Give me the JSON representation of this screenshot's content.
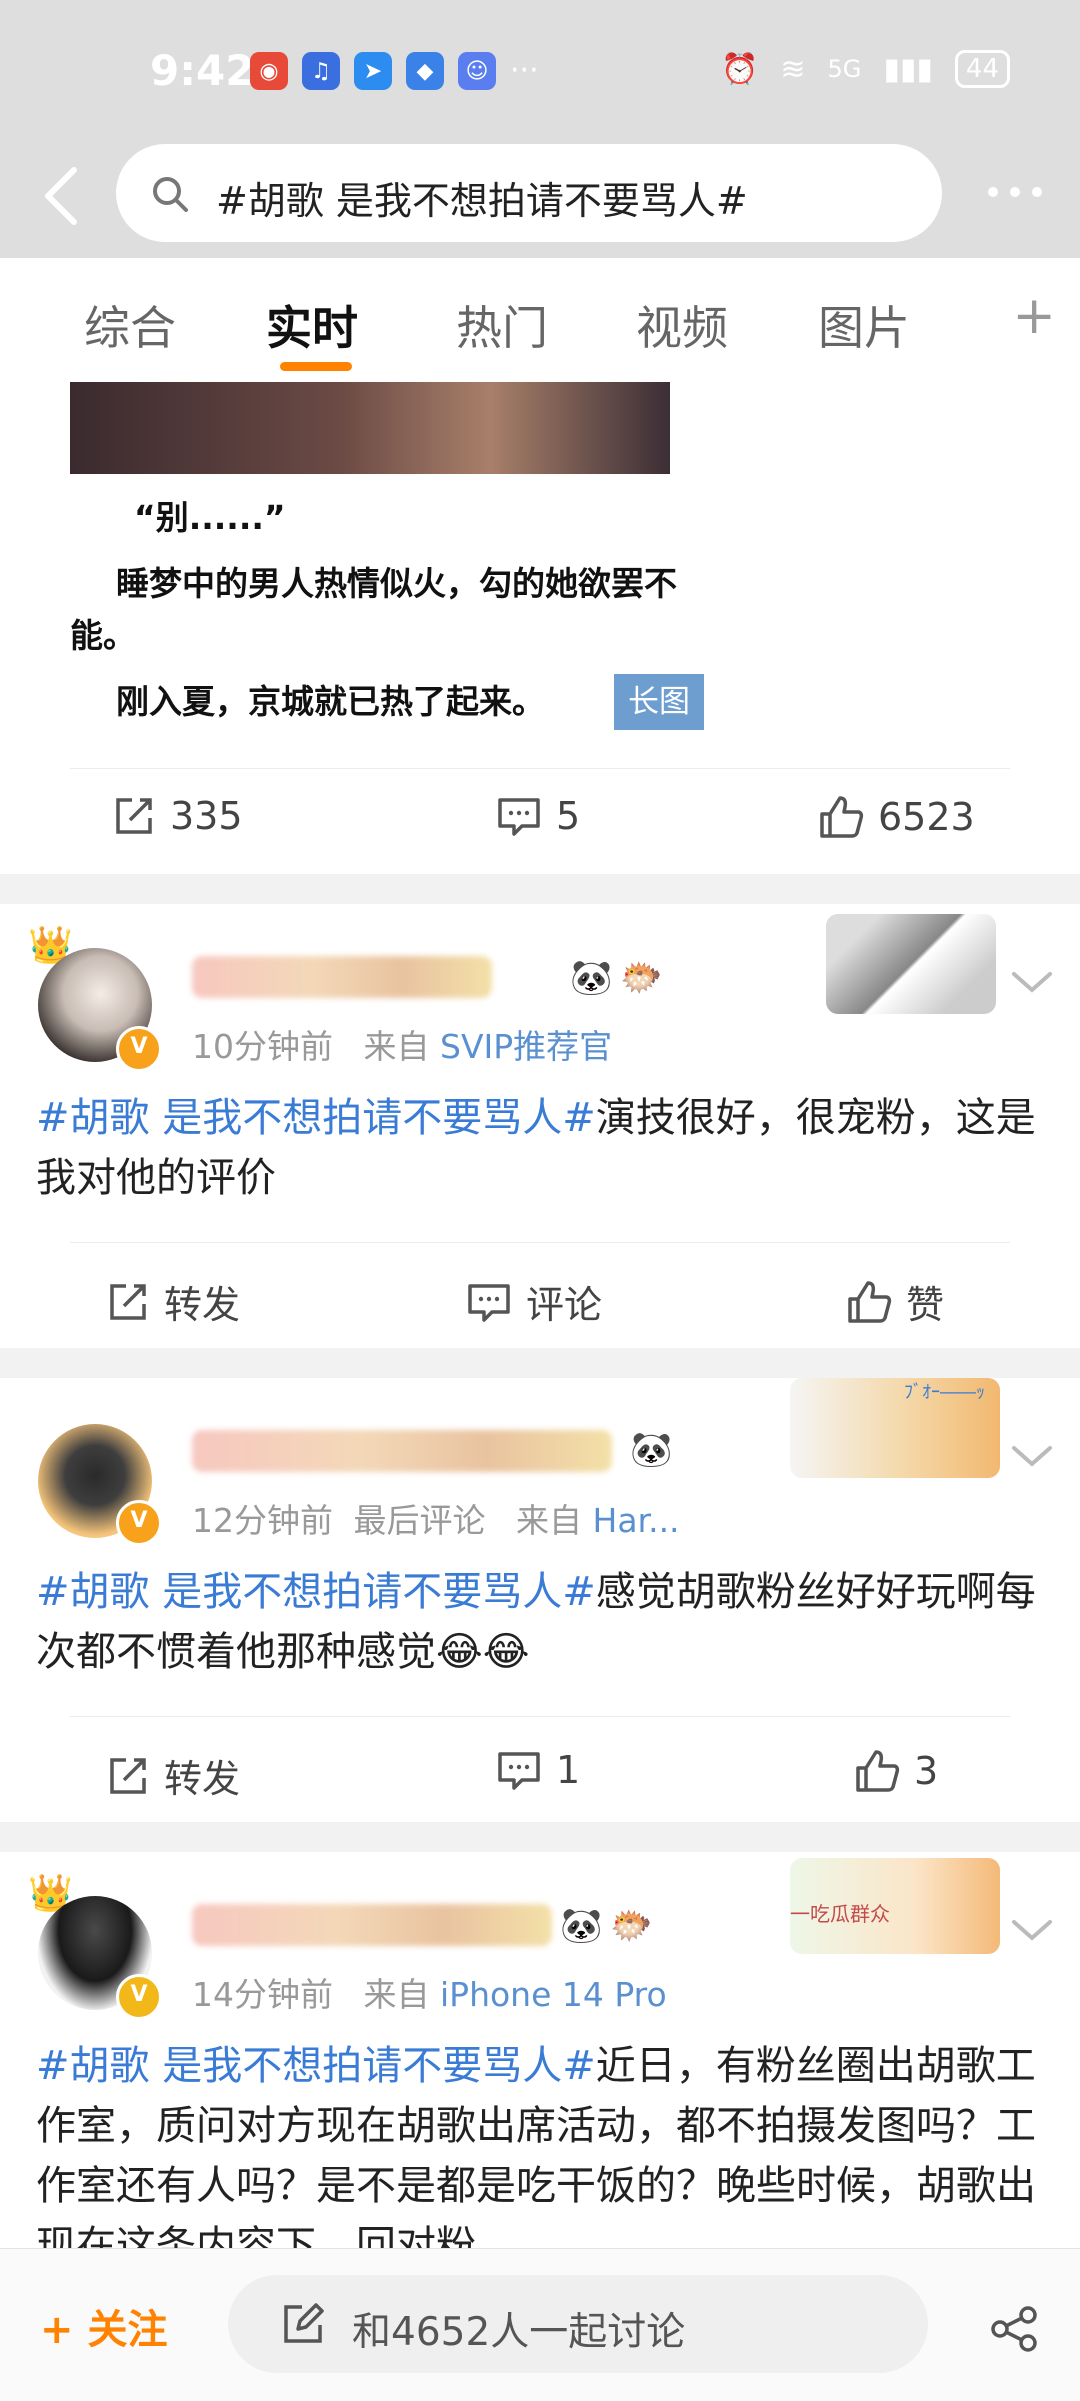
{
  "status_bar": {
    "time": "9:42",
    "network": "5G",
    "battery": "44",
    "more_indicator": "···"
  },
  "search": {
    "query": "#胡歌 是我不想拍请不要骂人#"
  },
  "tabs": [
    {
      "label": "综合"
    },
    {
      "label": "实时"
    },
    {
      "label": "热门"
    },
    {
      "label": "视频"
    },
    {
      "label": "图片"
    }
  ],
  "tab_plus": "+",
  "card1": {
    "lines": [
      "“别......”",
      "睡梦中的男人热情似火，勾的她欲罢不能。",
      "刚入夏，京城就已热了起来。"
    ],
    "long_image_badge": "长图",
    "repost_count": "335",
    "comment_count": "5",
    "like_count": "6523"
  },
  "posts": [
    {
      "meta_time": "10分钟前",
      "meta_from": "来自",
      "meta_source": "SVIP推荐官",
      "hashtag": "#胡歌 是我不想拍请不要骂人#",
      "text": "演技很好，很宠粉，这是我对他的评价",
      "repost_label": "转发",
      "comment_label": "评论",
      "like_label": "赞"
    },
    {
      "meta_time": "12分钟前",
      "meta_last": "最后评论",
      "meta_from": "来自",
      "meta_source": "Har...",
      "hashtag": "#胡歌 是我不想拍请不要骂人#",
      "text": "感觉胡歌粉丝好好玩啊每次都不惯着他那种感觉😂😂",
      "repost_label": "转发",
      "comment_count": "1",
      "like_count": "3",
      "decoration_text": "ﾌﾞｵｰ――ｯ"
    },
    {
      "meta_time": "14分钟前",
      "meta_from": "来自",
      "meta_source": "iPhone 14 Pro",
      "hashtag": "#胡歌 是我不想拍请不要骂人#",
      "text": "近日，有粉丝圈出胡歌工作室，质问对方现在胡歌出席活动，都不拍摄发图吗？工作室还有人吗？是不是都是吃干饭的？晚些时候，胡歌出现在这条内容下，回对粉",
      "decoration_text": "一吃瓜群众"
    }
  ],
  "bottom_bar": {
    "follow_label": "关注",
    "discuss_label": "和4652人一起讨论"
  },
  "colors": {
    "accent": "#ff8200",
    "link": "#3a7bd5",
    "source": "#5a8fd0",
    "verified": "#f7a21a"
  },
  "icons": [
    "back-icon",
    "search-icon",
    "more-icon",
    "repost-icon",
    "comment-icon",
    "like-icon",
    "chevron-down-icon",
    "edit-icon",
    "share-icon",
    "crown-icon",
    "verified-icon"
  ]
}
